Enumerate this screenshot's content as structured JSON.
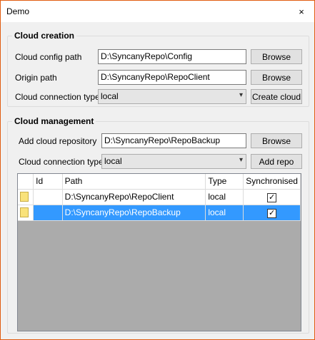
{
  "window": {
    "title": "Demo",
    "close_glyph": "×"
  },
  "cloud_creation": {
    "title": "Cloud creation",
    "config_label": "Cloud config path",
    "config_value": "D:\\SyncanyRepo\\Config",
    "origin_label": "Origin path",
    "origin_value": "D:\\SyncanyRepo\\RepoClient",
    "type_label": "Cloud connection type",
    "type_value": "local",
    "browse1": "Browse",
    "browse2": "Browse",
    "create_button": "Create cloud"
  },
  "cloud_management": {
    "title": "Cloud management",
    "add_label": "Add cloud repository",
    "add_value": "D:\\SyncanyRepo\\RepoBackup",
    "type_label": "Cloud connection type",
    "type_value": "local",
    "browse": "Browse",
    "add_button": "Add repo"
  },
  "grid": {
    "columns": [
      "Id",
      "Path",
      "Type",
      "Synchronised"
    ],
    "rows": [
      {
        "id": "",
        "path": "D:\\SyncanyRepo\\RepoClient",
        "type": "local",
        "synchronised": true,
        "selected": false
      },
      {
        "id": "",
        "path": "D:\\SyncanyRepo\\RepoBackup",
        "type": "local",
        "synchronised": true,
        "selected": true
      }
    ]
  },
  "icons": {
    "folder": "folder-icon",
    "check": "✓",
    "dropdown": "▾"
  },
  "colors": {
    "selection": "#3399ff",
    "grid_empty": "#ababab"
  }
}
